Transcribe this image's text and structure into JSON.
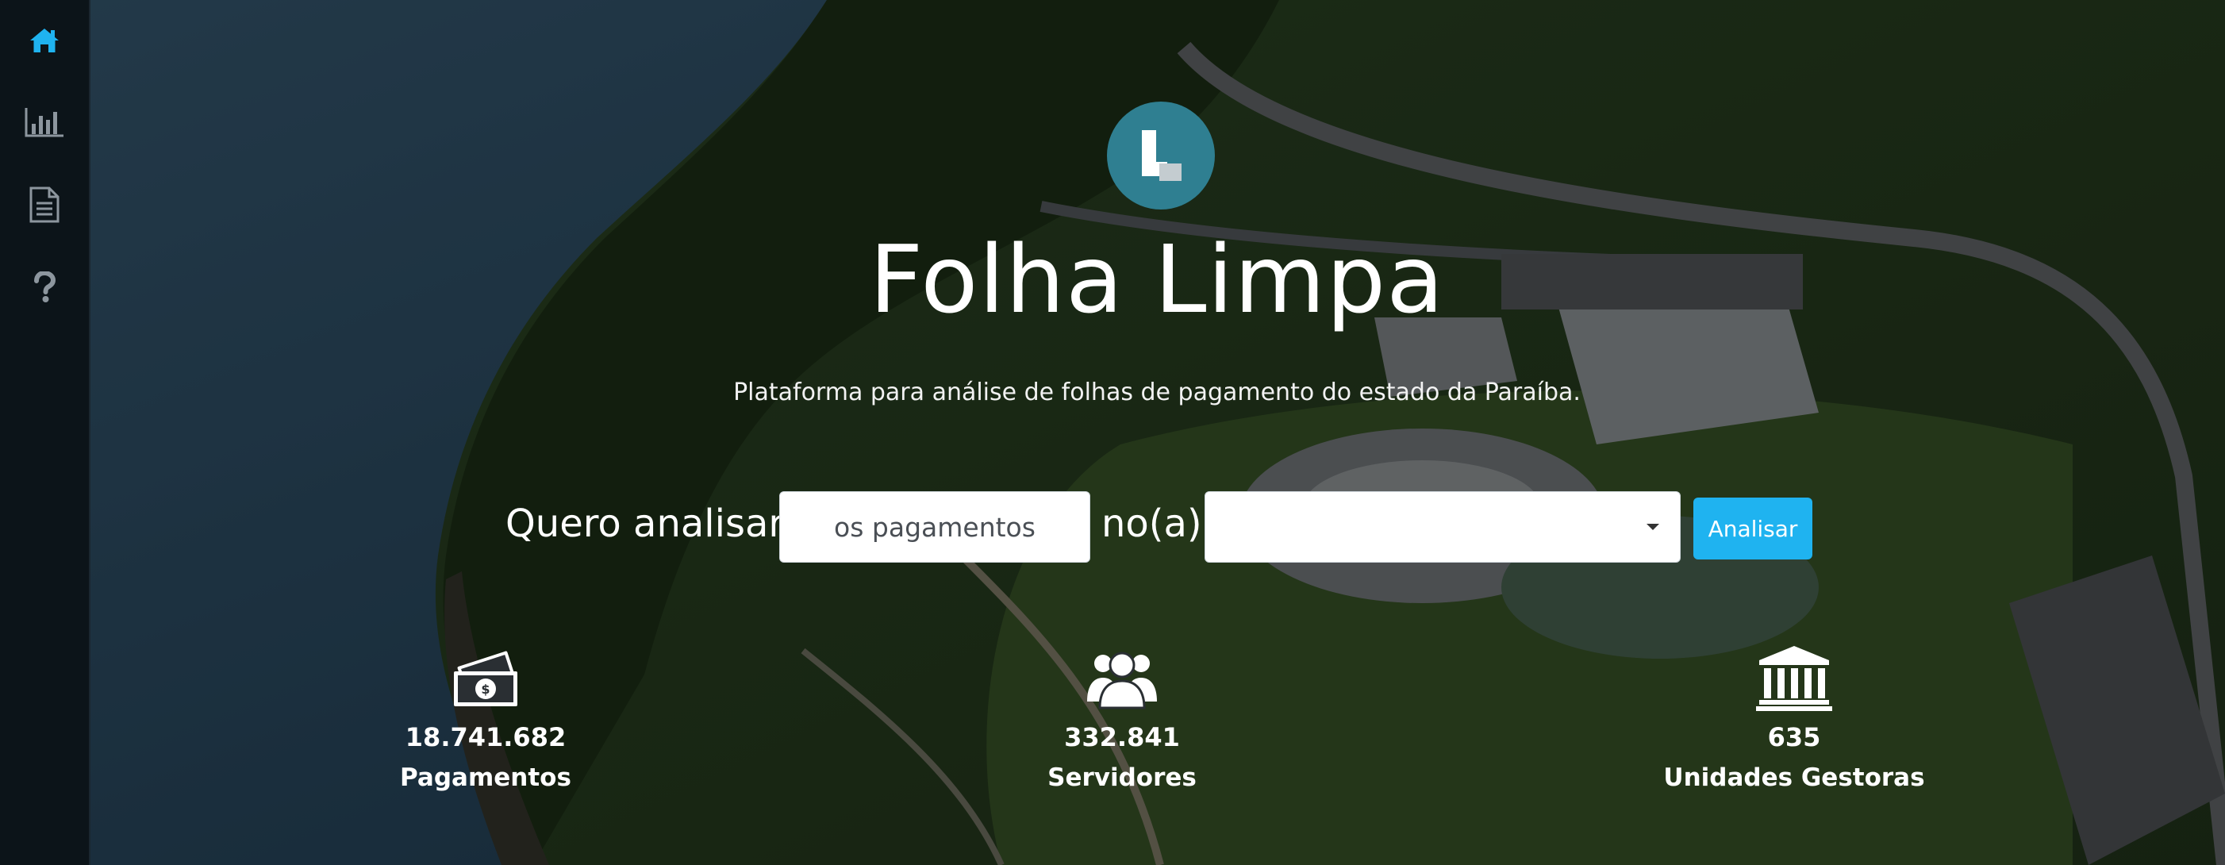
{
  "app": {
    "title": "Folha Limpa",
    "subtitle": "Plataforma para análise de folhas de pagamento do estado da Paraíba.",
    "accent_color": "#1fb3f0",
    "logo_color": "#2f7f91"
  },
  "sidebar": {
    "items": [
      {
        "name": "home",
        "icon": "home-icon",
        "active": true
      },
      {
        "name": "charts",
        "icon": "bar-chart-icon",
        "active": false
      },
      {
        "name": "reports",
        "icon": "document-icon",
        "active": false
      },
      {
        "name": "help",
        "icon": "question-icon",
        "active": false
      }
    ]
  },
  "query": {
    "prefix": "Quero analisar",
    "input_value": "os pagamentos",
    "connector": "no(a)",
    "select_value": "",
    "button_label": "Analisar"
  },
  "stats": [
    {
      "icon": "money-icon",
      "value": "18.741.682",
      "label": "Pagamentos"
    },
    {
      "icon": "users-icon",
      "value": "332.841",
      "label": "Servidores"
    },
    {
      "icon": "bank-icon",
      "value": "635",
      "label": "Unidades Gestoras"
    }
  ]
}
